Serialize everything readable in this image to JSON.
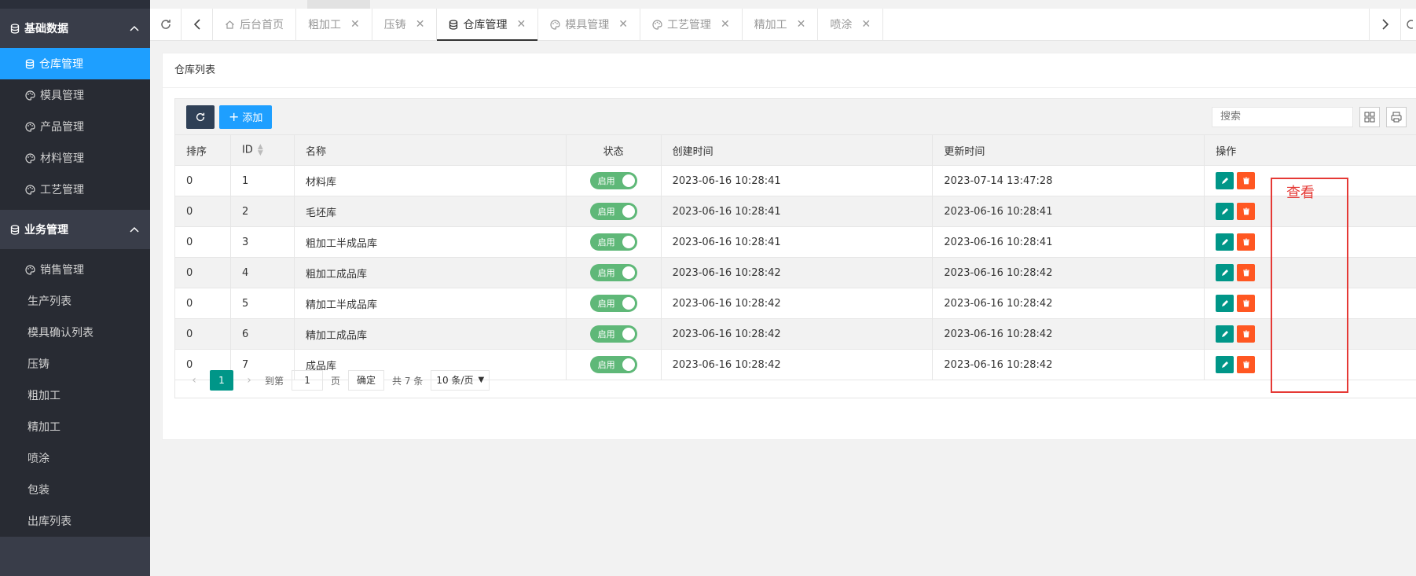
{
  "sidebar": {
    "groups": [
      {
        "label": "基础数据",
        "items": [
          {
            "label": "仓库管理",
            "icon": "database-icon",
            "active": true
          },
          {
            "label": "模具管理",
            "icon": "palette-icon"
          },
          {
            "label": "产品管理",
            "icon": "palette-icon"
          },
          {
            "label": "材料管理",
            "icon": "palette-icon"
          },
          {
            "label": "工艺管理",
            "icon": "palette-icon"
          }
        ]
      },
      {
        "label": "业务管理",
        "items": [
          {
            "label": "销售管理",
            "icon": "palette-icon"
          },
          {
            "label": "生产列表"
          },
          {
            "label": "模具确认列表"
          },
          {
            "label": "压铸"
          },
          {
            "label": "粗加工"
          },
          {
            "label": "精加工"
          },
          {
            "label": "喷涂"
          },
          {
            "label": "包装"
          },
          {
            "label": "出库列表"
          }
        ]
      }
    ]
  },
  "tabs": [
    {
      "label": "后台首页",
      "icon": "home-icon",
      "closable": false
    },
    {
      "label": "粗加工",
      "closable": true
    },
    {
      "label": "压铸",
      "closable": true
    },
    {
      "label": "仓库管理",
      "icon": "database-icon",
      "closable": true,
      "active": true
    },
    {
      "label": "模具管理",
      "icon": "palette-icon",
      "closable": true
    },
    {
      "label": "工艺管理",
      "icon": "palette-icon",
      "closable": true
    },
    {
      "label": "精加工",
      "closable": true
    },
    {
      "label": "喷涂",
      "closable": true
    }
  ],
  "card": {
    "title": "仓库列表",
    "add_label": "添加",
    "search_placeholder": "搜索"
  },
  "table": {
    "headers": [
      "排序",
      "ID",
      "名称",
      "状态",
      "创建时间",
      "更新时间",
      "操作"
    ],
    "switch_label": "启用",
    "rows": [
      {
        "sort": "0",
        "id": "1",
        "name": "材料库",
        "created": "2023-06-16 10:28:41",
        "updated": "2023-07-14 13:47:28"
      },
      {
        "sort": "0",
        "id": "2",
        "name": "毛坯库",
        "created": "2023-06-16 10:28:41",
        "updated": "2023-06-16 10:28:41"
      },
      {
        "sort": "0",
        "id": "3",
        "name": "粗加工半成品库",
        "created": "2023-06-16 10:28:41",
        "updated": "2023-06-16 10:28:41"
      },
      {
        "sort": "0",
        "id": "4",
        "name": "粗加工成品库",
        "created": "2023-06-16 10:28:42",
        "updated": "2023-06-16 10:28:42"
      },
      {
        "sort": "0",
        "id": "5",
        "name": "精加工半成品库",
        "created": "2023-06-16 10:28:42",
        "updated": "2023-06-16 10:28:42"
      },
      {
        "sort": "0",
        "id": "6",
        "name": "精加工成品库",
        "created": "2023-06-16 10:28:42",
        "updated": "2023-06-16 10:28:42"
      },
      {
        "sort": "0",
        "id": "7",
        "name": "成品库",
        "created": "2023-06-16 10:28:42",
        "updated": "2023-06-16 10:28:42"
      }
    ]
  },
  "pager": {
    "current": "1",
    "goto_label": "到第",
    "goto_value": "1",
    "page_label": "页",
    "confirm": "确定",
    "total": "共 7 条",
    "per_page": "10 条/页"
  },
  "annotation": {
    "label": "查看",
    "color": "#e53935"
  }
}
